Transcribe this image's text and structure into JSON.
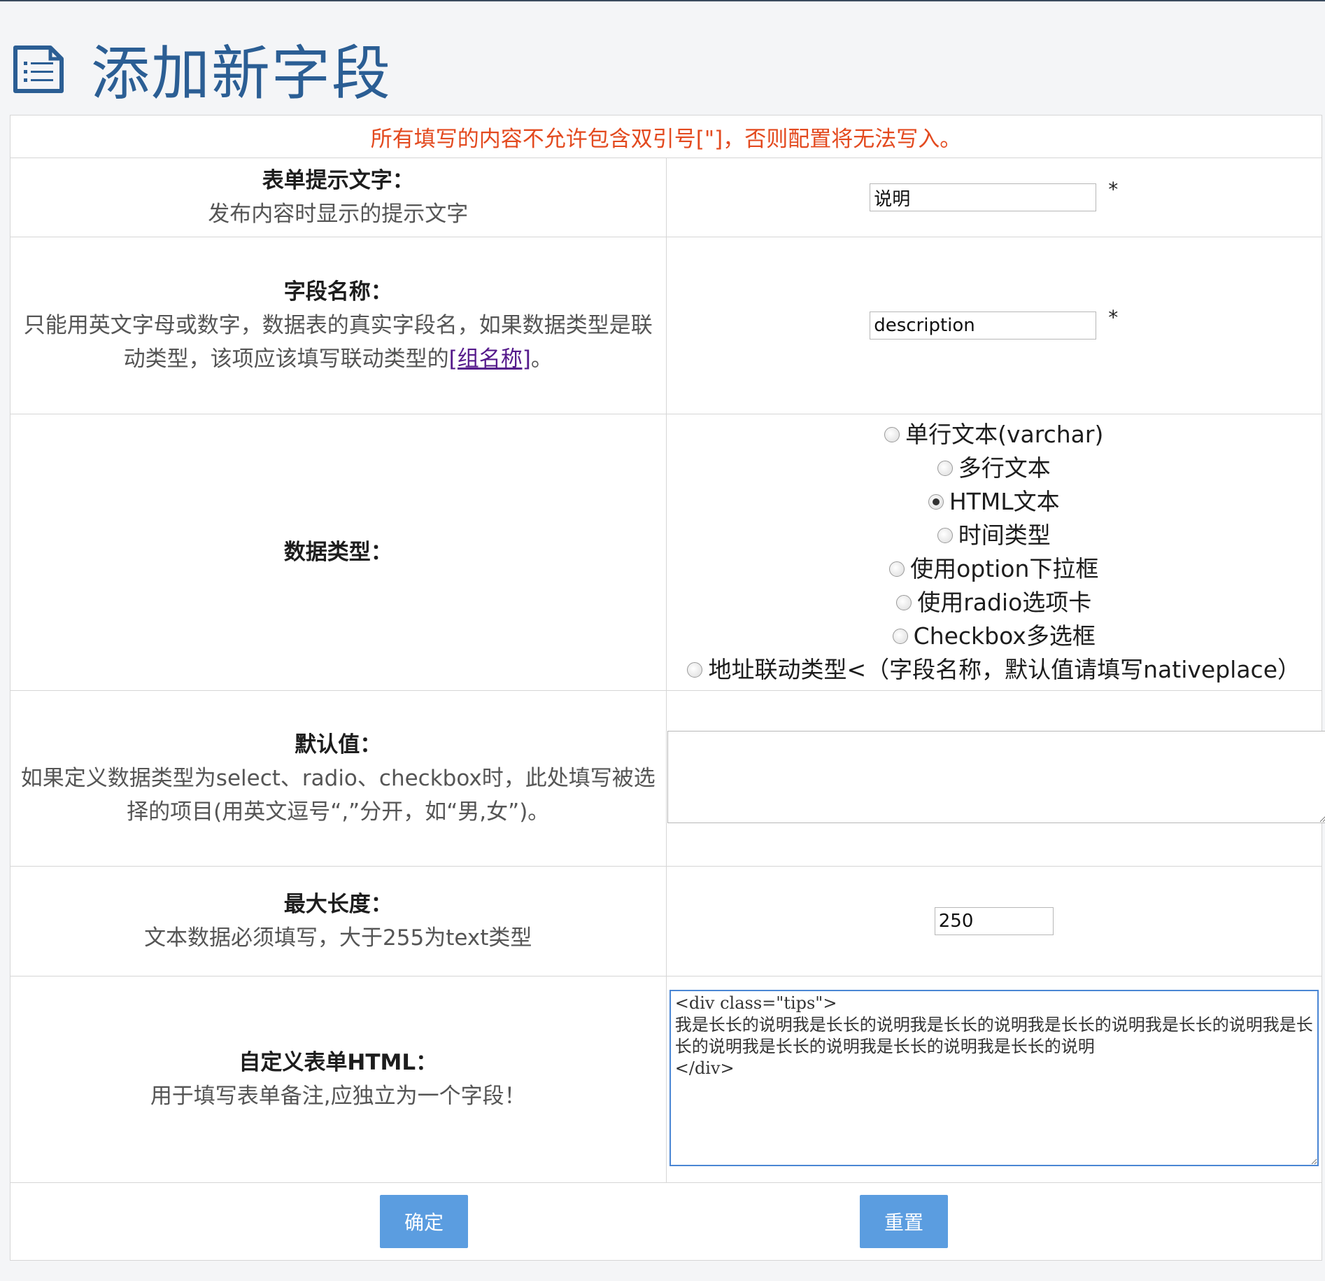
{
  "page": {
    "title": "添加新字段",
    "notice": "所有填写的内容不允许包含双引号[\"]，否则配置将无法写入。"
  },
  "fields": {
    "prompt_text": {
      "label": "表单提示文字：",
      "help": "发布内容时显示的提示文字",
      "value": "说明",
      "required_mark": "*"
    },
    "field_name": {
      "label": "字段名称：",
      "help": "只能用英文字母或数字，数据表的真实字段名，如果数据类型是联动类型，该项应该填写联动类型的",
      "link_text": "[组名称]",
      "help_suffix": "。",
      "value": "description",
      "required_mark": "*"
    },
    "data_type": {
      "label": "数据类型：",
      "options": [
        {
          "label": "单行文本(varchar)",
          "checked": false
        },
        {
          "label": "多行文本",
          "checked": false
        },
        {
          "label": "HTML文本",
          "checked": true
        },
        {
          "label": "时间类型",
          "checked": false
        },
        {
          "label": "使用option下拉框",
          "checked": false
        },
        {
          "label": "使用radio选项卡",
          "checked": false
        },
        {
          "label": "Checkbox多选框",
          "checked": false
        },
        {
          "label": "地址联动类型<（字段名称，默认值请填写nativeplace）",
          "checked": false
        }
      ]
    },
    "default_value": {
      "label": "默认值：",
      "help": "如果定义数据类型为select、radio、checkbox时，此处填写被选择的项目(用英文逗号“,”分开，如“男,女”)。",
      "value": ""
    },
    "max_length": {
      "label": "最大长度：",
      "help": "文本数据必须填写，大于255为text类型",
      "value": "250"
    },
    "custom_html": {
      "label": "自定义表单HTML：",
      "help": "用于填写表单备注,应独立为一个字段！",
      "value": "<div class=\"tips\">\n我是长长的说明我是长长的说明我是长长的说明我是长长的说明我是长长的说明我是长长的说明我是长长的说明我是长长的说明我是长长的说明\n</div>"
    }
  },
  "buttons": {
    "submit": "确定",
    "reset": "重置"
  },
  "colors": {
    "title": "#2b5e94",
    "notice": "#e34a1f",
    "button": "#5b9de0"
  }
}
